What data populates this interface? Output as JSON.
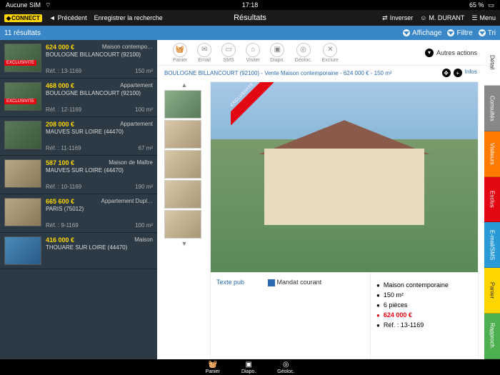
{
  "status": {
    "sim": "Aucune SIM",
    "time": "17:18",
    "battery": "65 %"
  },
  "nav": {
    "logo": "CONNECT",
    "back": "Précédent",
    "save": "Enregistrer la recherche",
    "title": "Résultats",
    "invert": "Inverser",
    "user": "M. DURANT",
    "menu": "Menu"
  },
  "filter": {
    "count": "11 résultats",
    "display": "Affichage",
    "filter": "Filtre",
    "sort": "Tri"
  },
  "actions": {
    "panier": "Panier",
    "email": "Email",
    "sms": "SMS",
    "visiter": "Visiter",
    "diapo": "Diapo.",
    "geoloc": "Géoloc.",
    "exclure": "Exclure",
    "other": "Autres actions",
    "infos": "Infos"
  },
  "listings": [
    {
      "price": "624 000 €",
      "type": "Maison contempo…",
      "loc": "BOULOGNE BILLANCOURT (92100)",
      "ref": "Réf. : 13-1169",
      "area": "150 m²",
      "excl": true,
      "img": "green"
    },
    {
      "price": "468 000 €",
      "type": "Appartement",
      "loc": "BOULOGNE BILLANCOURT (92100)",
      "ref": "Réf. : 12-1169",
      "area": "100 m²",
      "excl": true,
      "img": "green"
    },
    {
      "price": "208 000 €",
      "type": "Appartement",
      "loc": "MAUVES SUR LOIRE (44470)",
      "ref": "Réf. : 11-1169",
      "area": "67 m²",
      "excl": false,
      "img": "green"
    },
    {
      "price": "587 100 €",
      "type": "Maison de Maître",
      "loc": "MAUVES SUR LOIRE (44470)",
      "ref": "Réf. : 10-1169",
      "area": "190 m²",
      "excl": false,
      "img": "interior"
    },
    {
      "price": "665 600 €",
      "type": "Appartement Dupl…",
      "loc": "PARIS (75012)",
      "ref": "Réf. : 9-1169",
      "area": "100 m²",
      "excl": false,
      "img": "interior"
    },
    {
      "price": "416 000 €",
      "type": "Maison",
      "loc": "THOUARE SUR LOIRE (44470)",
      "ref": "",
      "area": "",
      "excl": false,
      "img": "pool"
    }
  ],
  "detail": {
    "header": "BOULOGNE BILLANCOURT (92100) - Vente Maison contemporaine - 624 000 € - 150 m²",
    "exclusivite": "EXCLUSIVITE",
    "pub": "Texte pub",
    "mandat": "Mandat courant",
    "bullets": {
      "type": "Maison contemporaine",
      "area": "150 m²",
      "rooms": "6 pièces",
      "price": "624 000 €",
      "ref": "Réf. : 13-1169"
    }
  },
  "tabs": [
    {
      "label": "Détail",
      "color": "#ffffff",
      "text": "#333"
    },
    {
      "label": "Consultés",
      "color": "#888888"
    },
    {
      "label": "Visiteurs",
      "color": "#ff7a00"
    },
    {
      "label": "Exclus",
      "color": "#e30613"
    },
    {
      "label": "E-mail/SMS",
      "color": "#2a9ad6"
    },
    {
      "label": "Panier",
      "color": "#ffd500",
      "text": "#333"
    },
    {
      "label": "Rapproch.",
      "color": "#4caf50"
    }
  ],
  "bottom": {
    "panier": "Panier",
    "diapo": "Diapo.",
    "geoloc": "Géoloc."
  }
}
